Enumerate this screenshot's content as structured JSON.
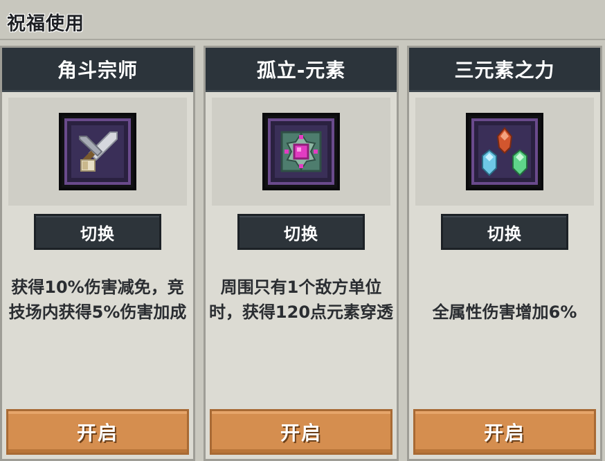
{
  "window": {
    "title": "祝福使用"
  },
  "cards": [
    {
      "title": "角斗宗师",
      "icon": "crossed-swords-icon",
      "switch_label": "切换",
      "description": "获得10%伤害减免，竞技场内获得5%伤害加成",
      "open_label": "开启"
    },
    {
      "title": "孤立-元素",
      "icon": "pink-gem-rune-icon",
      "switch_label": "切换",
      "description": "周围只有1个敌方单位时，获得120点元素穿透",
      "open_label": "开启"
    },
    {
      "title": "三元素之力",
      "icon": "three-crystals-icon",
      "switch_label": "切换",
      "description": "全属性伤害增加6%",
      "open_label": "开启"
    }
  ],
  "colors": {
    "header_bg": "#2c343b",
    "card_bg": "#dcdbd3",
    "open_button": "#d58e4f",
    "switch_button": "#2d343a"
  }
}
